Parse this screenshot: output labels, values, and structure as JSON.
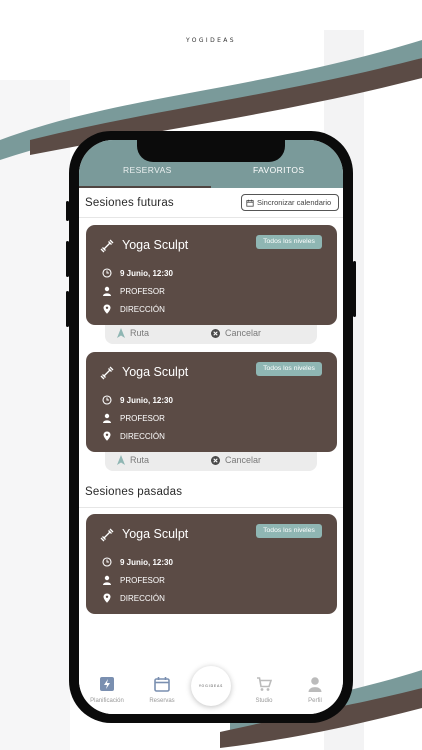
{
  "brand": "YOGIDEAS",
  "tabs": {
    "reservas": "RESERVAS",
    "favoritos": "FAVORITOS"
  },
  "future_title": "Sesiones futuras",
  "sync_label": "Sincronizar calendario",
  "past_title": "Sesiones pasadas",
  "cards": [
    {
      "title": "Yoga Sculpt",
      "level": "Todos los niveles",
      "datetime": "9 Junio, 12:30",
      "teacher": "PROFESOR",
      "address": "DIRECCIÓN"
    },
    {
      "title": "Yoga Sculpt",
      "level": "Todos los niveles",
      "datetime": "9 Junio, 12:30",
      "teacher": "PROFESOR",
      "address": "DIRECCIÓN"
    },
    {
      "title": "Yoga Sculpt",
      "level": "Todos los niveles",
      "datetime": "9 Junio, 12:30",
      "teacher": "PROFESOR",
      "address": "DIRECCIÓN"
    }
  ],
  "actions": {
    "route": "Ruta",
    "cancel": "Cancelar"
  },
  "nav": {
    "planificacion": "Planificación",
    "reservas": "Reservas",
    "studio": "Studio",
    "perfil": "Perfil",
    "center_label": "YOGIDEAS"
  },
  "colors": {
    "teal": "#7a9a9a",
    "brown": "#5b4b45",
    "badge": "#8fb6b3"
  }
}
